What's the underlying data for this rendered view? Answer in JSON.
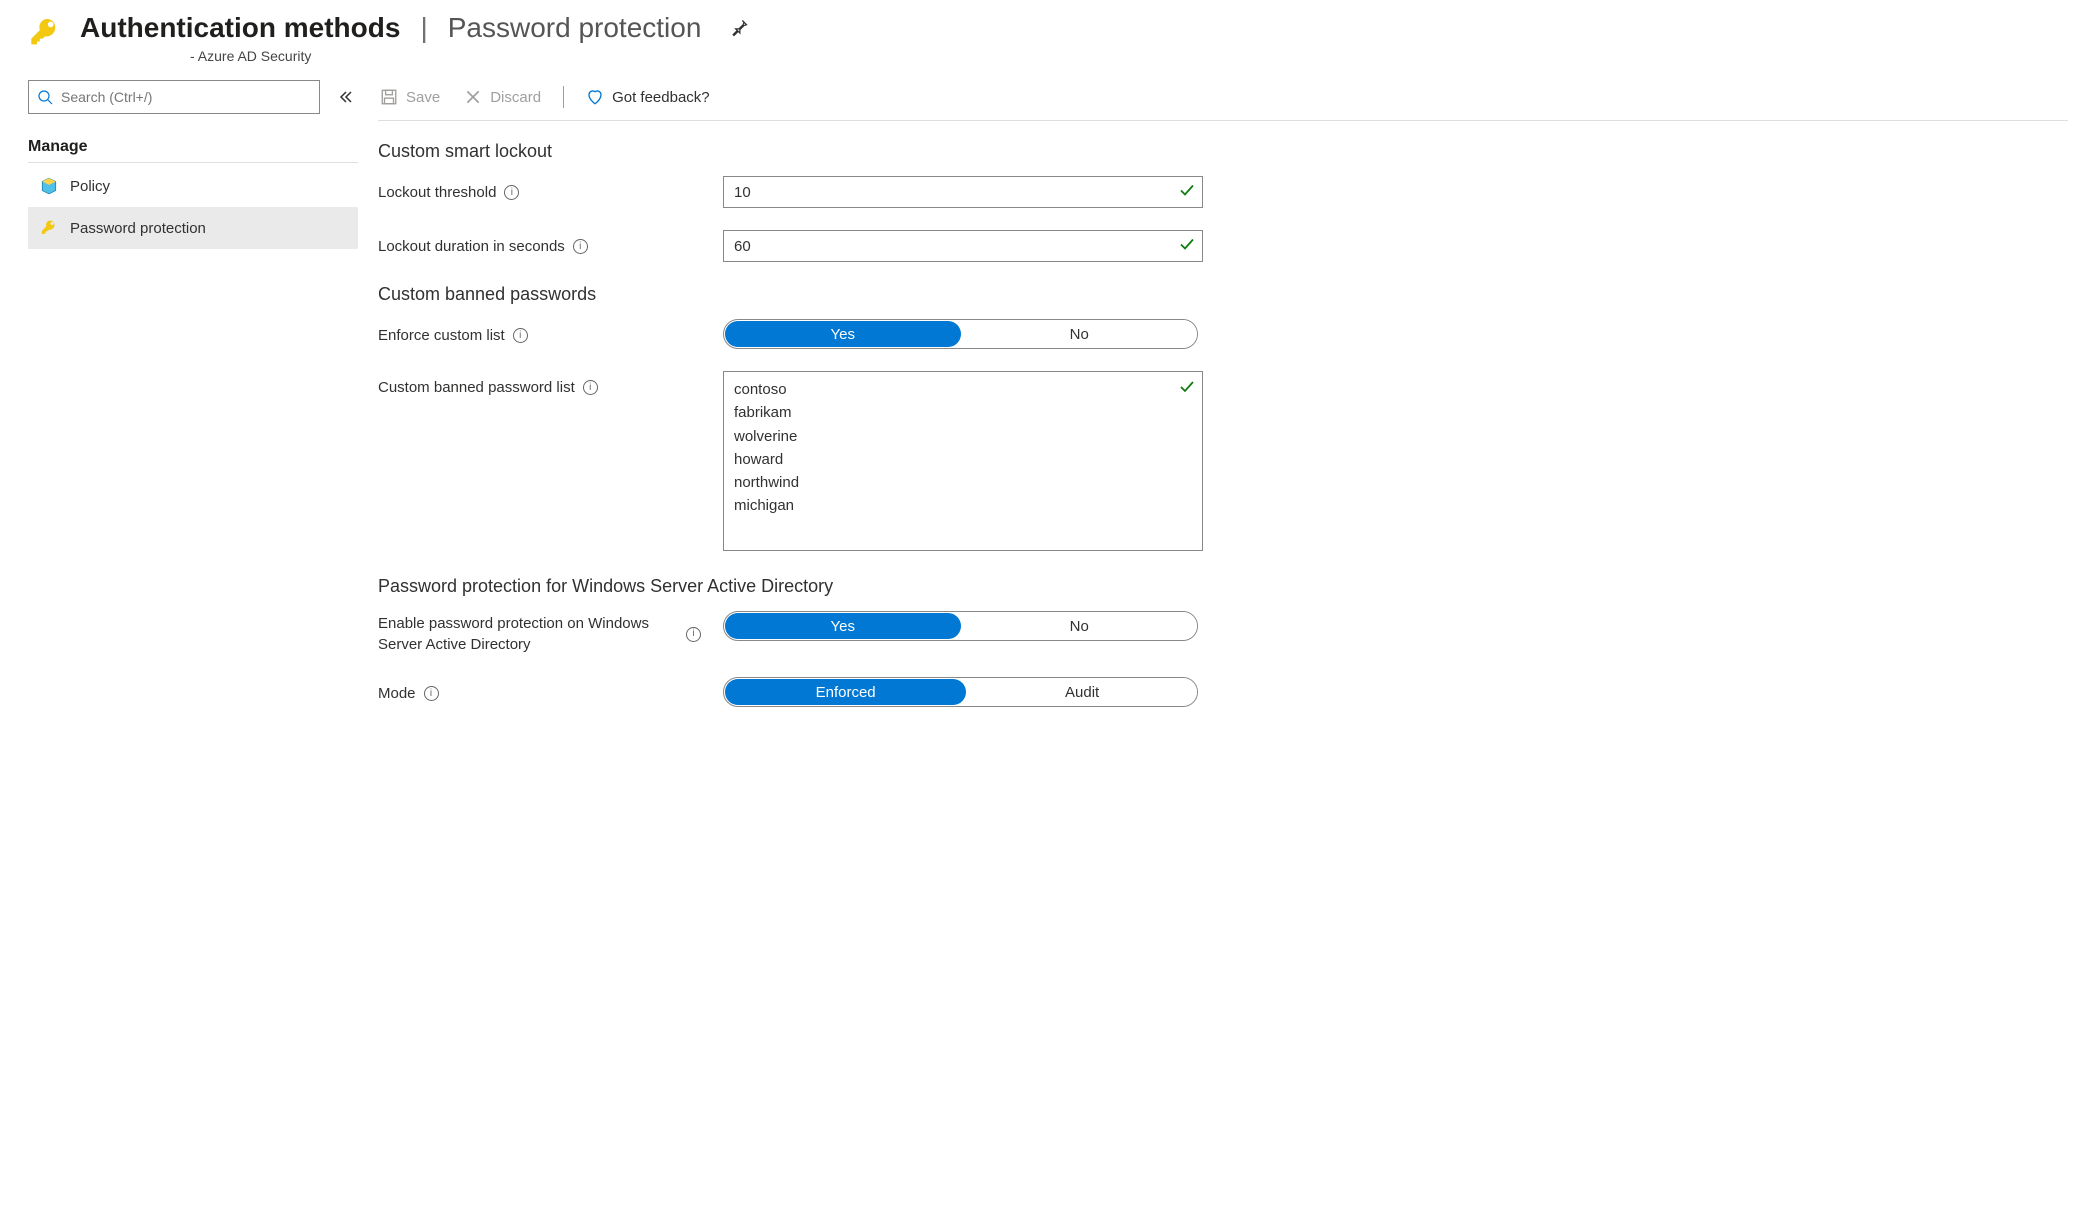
{
  "header": {
    "title_strong": "Authentication methods",
    "title_light": "Password protection",
    "subtitle": "- Azure AD Security"
  },
  "sidebar": {
    "search_placeholder": "Search (Ctrl+/)",
    "section": "Manage",
    "items": [
      {
        "label": "Policy",
        "active": false
      },
      {
        "label": "Password protection",
        "active": true
      }
    ]
  },
  "actions": {
    "save": "Save",
    "discard": "Discard",
    "feedback": "Got feedback?"
  },
  "form": {
    "section_lockout": "Custom smart lockout",
    "lockout_threshold_label": "Lockout threshold",
    "lockout_threshold_value": "10",
    "lockout_duration_label": "Lockout duration in seconds",
    "lockout_duration_value": "60",
    "section_banned": "Custom banned passwords",
    "enforce_label": "Enforce custom list",
    "enforce_yes": "Yes",
    "enforce_no": "No",
    "enforce_selected": "Yes",
    "list_label": "Custom banned password list",
    "list_value": "contoso\nfabrikam\nwolverine\nhoward\nnorthwind\nmichigan",
    "section_winsrv": "Password protection for Windows Server Active Directory",
    "enable_win_label": "Enable password protection on Windows Server Active Directory",
    "enable_win_yes": "Yes",
    "enable_win_no": "No",
    "enable_win_selected": "Yes",
    "mode_label": "Mode",
    "mode_enforced": "Enforced",
    "mode_audit": "Audit",
    "mode_selected": "Enforced"
  }
}
